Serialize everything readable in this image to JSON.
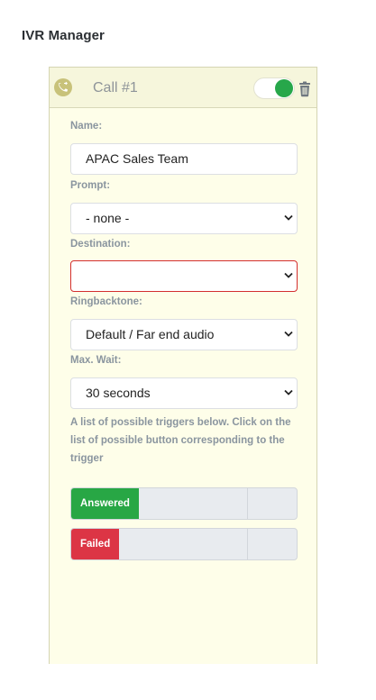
{
  "page": {
    "title": "IVR Manager"
  },
  "call": {
    "title": "Call #1",
    "enabled": true,
    "icons": {
      "call": "call-transfer-icon",
      "delete": "trash-icon"
    }
  },
  "form": {
    "name_label": "Name:",
    "name_value": "APAC Sales Team",
    "prompt_label": "Prompt:",
    "prompt_value": "- none -",
    "destination_label": "Destination:",
    "destination_value": "",
    "ringback_label": "Ringbacktone:",
    "ringback_value": "Default / Far end audio",
    "maxwait_label": "Max. Wait:",
    "maxwait_value": "30 seconds",
    "help_text": "A list of possible triggers below. Click on the list of possible button corresponding to the trigger"
  },
  "triggers": [
    {
      "label": "Answered",
      "color": "#28a745"
    },
    {
      "label": "Failed",
      "color": "#dc3545"
    }
  ],
  "colors": {
    "card_bg": "#fefee9",
    "toggle_on": "#27a74a",
    "error_border": "#d32f2f"
  }
}
